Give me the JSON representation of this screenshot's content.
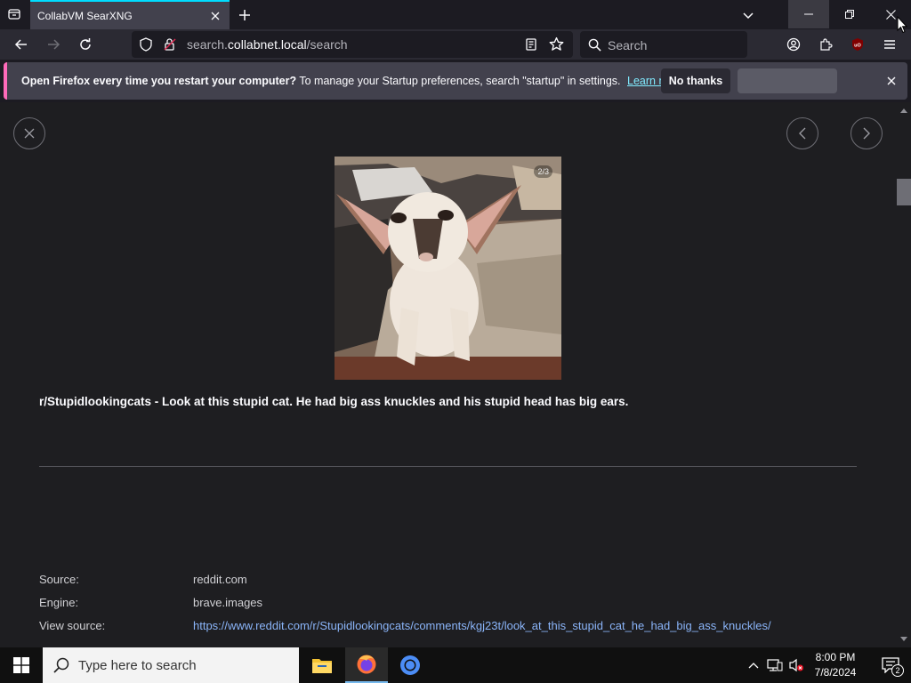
{
  "browser": {
    "tab": {
      "title": "CollabVM SearXNG"
    },
    "url": {
      "domain": "search.collabnet.local",
      "prefix": "search.",
      "host": "collabnet.local",
      "path": "/search"
    },
    "search": {
      "placeholder": "Search"
    }
  },
  "notification": {
    "bold_text": "Open Firefox every time you restart your computer?",
    "text": "To manage your Startup preferences, search \"startup\" in settings.",
    "learn_more": "Learn more",
    "no_thanks": "No thanks"
  },
  "result": {
    "counter": "2/3",
    "title": "r/Stupidlookingcats - Look at this stupid cat. He had big ass knuckles and his stupid head has big ears.",
    "source_label": "Source:",
    "source_value": "reddit.com",
    "engine_label": "Engine:",
    "engine_value": "brave.images",
    "view_source_label": "View source:",
    "view_source_url": "https://www.reddit.com/r/Stupidlookingcats/comments/kgj23t/look_at_this_stupid_cat_he_had_big_ass_knuckles/"
  },
  "taskbar": {
    "search_placeholder": "Type here to search",
    "time": "8:00 PM",
    "date": "7/8/2024",
    "notification_count": "2"
  },
  "colors": {
    "accent_tab": "#00ddff",
    "notif_border": "#ff6bba",
    "link": "#8ab4f8",
    "learn_more": "#80ebff"
  }
}
